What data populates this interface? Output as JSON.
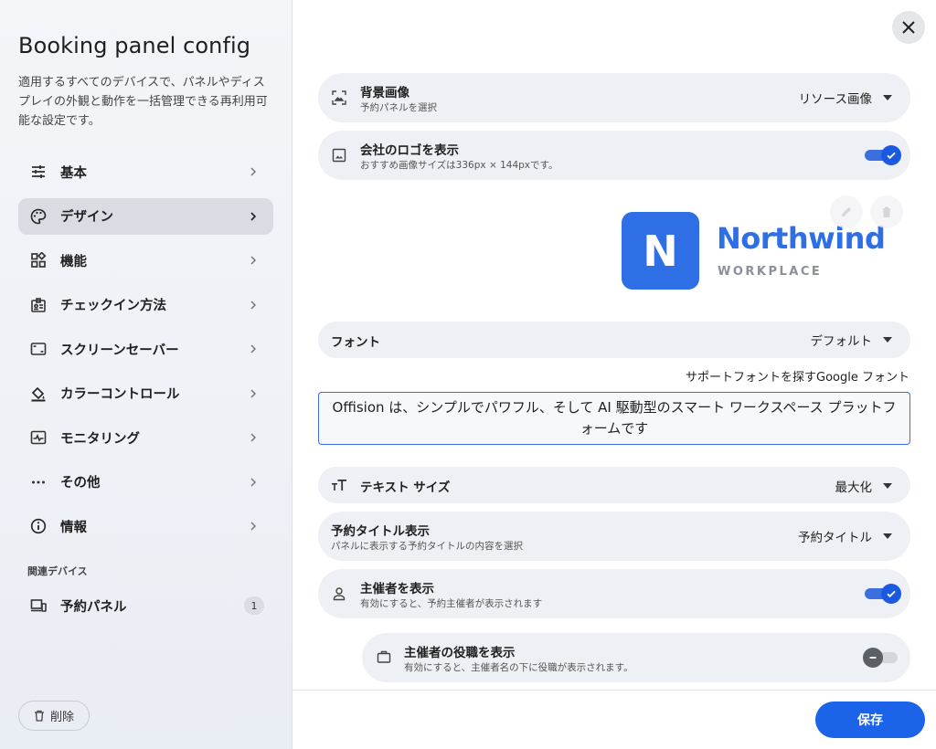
{
  "sidebar": {
    "title": "Booking panel config",
    "description": "適用するすべてのデバイスで、パネルやディスプレイの外観と動作を一括管理できる再利用可能な設定です。",
    "items": [
      {
        "label": "基本",
        "icon": "sliders-icon"
      },
      {
        "label": "デザイン",
        "icon": "palette-icon",
        "active": true
      },
      {
        "label": "機能",
        "icon": "widgets-icon"
      },
      {
        "label": "チェックイン方法",
        "icon": "badge-icon"
      },
      {
        "label": "スクリーンセーバー",
        "icon": "screensaver-icon"
      },
      {
        "label": "カラーコントロール",
        "icon": "paint-bucket-icon"
      },
      {
        "label": "モニタリング",
        "icon": "monitoring-icon"
      },
      {
        "label": "その他",
        "icon": "more-icon"
      },
      {
        "label": "情報",
        "icon": "info-icon"
      }
    ],
    "related_section_label": "関連デバイス",
    "related_device": {
      "label": "予約パネル",
      "count": "1",
      "icon": "devices-icon"
    },
    "delete_label": "削除"
  },
  "main": {
    "background": {
      "title": "背景画像",
      "subtitle": "予約パネルを選択",
      "value": "リソース画像"
    },
    "logo_toggle": {
      "title": "会社のロゴを表示",
      "subtitle": "おすすめ画像サイズは336px × 144pxです。",
      "on": true
    },
    "logo": {
      "letter": "N",
      "wordmark": "Northwind",
      "tagline": "WORKPLACE"
    },
    "font": {
      "title": "フォント",
      "value": "デフォルト"
    },
    "font_link": "サポートフォントを探すGoogle フォント",
    "preview_text": "Offision は、シンプルでパワフル、そして AI 駆動型のスマート ワークスペース プラットフォームです",
    "text_size": {
      "title": "テキスト サイズ",
      "value": "最大化"
    },
    "title_display": {
      "title": "予約タイトル表示",
      "subtitle": "パネルに表示する予約タイトルの内容を選択",
      "value": "予約タイトル"
    },
    "organizer": {
      "title": "主催者を表示",
      "subtitle": "有効にすると、予約主催者が表示されます",
      "on": true
    },
    "organizer_role": {
      "title": "主催者の役職を表示",
      "subtitle": "有効にすると、主催者名の下に役職が表示されます。",
      "on": false
    }
  },
  "footer": {
    "save_label": "保存"
  },
  "colors": {
    "accent": "#1b63e8",
    "toggle_on": "#3b6fe0",
    "logo_blue": "#2f6fe6"
  }
}
